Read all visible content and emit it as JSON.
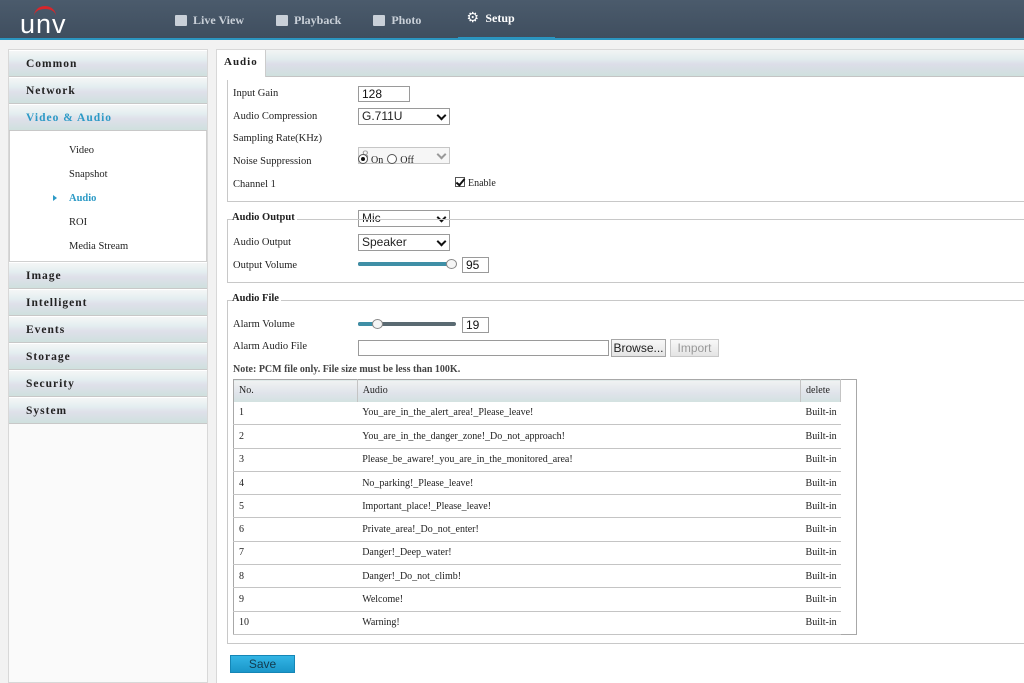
{
  "brand": {
    "logo_text": "unv"
  },
  "nav": {
    "items": [
      {
        "label": "Live View",
        "icon": "monitor-icon"
      },
      {
        "label": "Playback",
        "icon": "film-icon"
      },
      {
        "label": "Photo",
        "icon": "photo-icon"
      },
      {
        "label": "Setup",
        "icon": "gear-icon",
        "active": true
      }
    ]
  },
  "sidebar": {
    "sections": [
      {
        "label": "Common"
      },
      {
        "label": "Network"
      },
      {
        "label": "Video & Audio",
        "active": true,
        "children": [
          {
            "label": "Video"
          },
          {
            "label": "Snapshot"
          },
          {
            "label": "Audio",
            "active": true
          },
          {
            "label": "ROI"
          },
          {
            "label": "Media Stream"
          }
        ]
      },
      {
        "label": "Image"
      },
      {
        "label": "Intelligent"
      },
      {
        "label": "Events"
      },
      {
        "label": "Storage"
      },
      {
        "label": "Security"
      },
      {
        "label": "System"
      }
    ]
  },
  "main": {
    "tab": "Audio",
    "audio_input": {
      "input_gain": {
        "label": "Input Gain",
        "value": "128"
      },
      "compression": {
        "label": "Audio Compression",
        "value": "G.711U"
      },
      "sampling_rate": {
        "label": "Sampling Rate(KHz)",
        "value": "8",
        "disabled": true
      },
      "noise_suppression": {
        "label": "Noise Suppression",
        "options": [
          "On",
          "Off"
        ],
        "selected": "On"
      },
      "channel1": {
        "label": "Channel 1",
        "value": "Mic",
        "enable_label": "Enable",
        "enabled": true
      }
    },
    "audio_output": {
      "legend": "Audio Output",
      "output": {
        "label": "Audio Output",
        "value": "Speaker"
      },
      "volume": {
        "label": "Output Volume",
        "value": "95",
        "percent": 95
      }
    },
    "audio_file": {
      "legend": "Audio File",
      "alarm_volume": {
        "label": "Alarm Volume",
        "value": "19",
        "percent": 19
      },
      "alarm_file": {
        "label": "Alarm Audio File",
        "value": "",
        "browse_label": "Browse...",
        "import_label": "Import"
      },
      "note": "Note: PCM file only. File size must be less than 100K.",
      "table": {
        "columns": [
          "No.",
          "Audio",
          "delete"
        ],
        "rows": [
          [
            "1",
            "You_are_in_the_alert_area!_Please_leave!",
            "Built-in"
          ],
          [
            "2",
            "You_are_in_the_danger_zone!_Do_not_approach!",
            "Built-in"
          ],
          [
            "3",
            "Please_be_aware!_you_are_in_the_monitored_area!",
            "Built-in"
          ],
          [
            "4",
            "No_parking!_Please_leave!",
            "Built-in"
          ],
          [
            "5",
            "Important_place!_Please_leave!",
            "Built-in"
          ],
          [
            "6",
            "Private_area!_Do_not_enter!",
            "Built-in"
          ],
          [
            "7",
            "Danger!_Deep_water!",
            "Built-in"
          ],
          [
            "8",
            "Danger!_Do_not_climb!",
            "Built-in"
          ],
          [
            "9",
            "Welcome!",
            "Built-in"
          ],
          [
            "10",
            "Warning!",
            "Built-in"
          ]
        ]
      }
    },
    "save_label": "Save"
  },
  "colors": {
    "accent": "#2c9ac6",
    "topbar": "#45556a",
    "save": "#1ea3d6"
  }
}
